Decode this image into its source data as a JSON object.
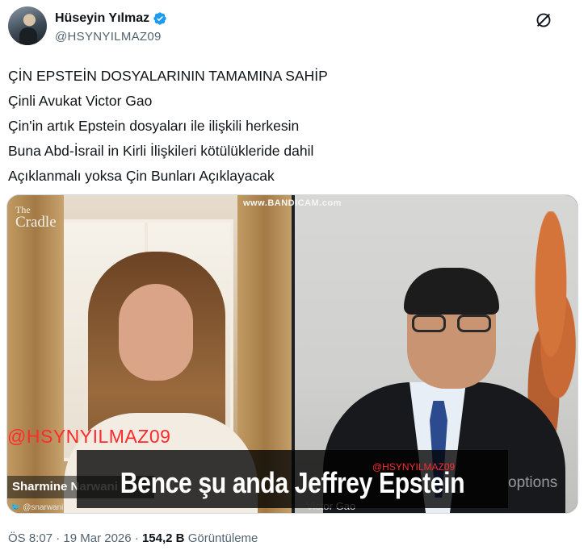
{
  "author": {
    "display_name": "Hüseyin Yılmaz",
    "handle": "@HSYNYILMAZ09",
    "verified_color": "#1d9bf0"
  },
  "tweet": {
    "lines": [
      "ÇİN EPSTEİN DOSYALARININ TAMAMINA SAHİP",
      "Çinli Avukat Victor Gao",
      "Çin'in artık Epstein dosyaları ile ilişkili herkesin",
      "Buna Abd-İsrail in Kirli İlişkileri kötülükleride dahil",
      "Açıklanmalı yoksa Çin Bunları Açıklayacak"
    ]
  },
  "video": {
    "brand_logo": [
      "The",
      "Cradle"
    ],
    "recorder_watermark": "www.BANDICAM.com",
    "watermark_left": "@HSYNYILMAZ09",
    "watermark_center": "@HSYNYILMAZ09",
    "lower_third_left": "Sharmine Narwani",
    "social_left": "🐦 @snarwani",
    "lower_third_right": "Victor Gao",
    "subtitle": "Bence şu anda Jeffrey Epstein",
    "options_text": "options"
  },
  "footer": {
    "time": "ÖS 8:07",
    "sep1": "·",
    "date": "19 Mar 2026",
    "sep2": "·",
    "views_count": "154,2 B",
    "views_label": "Görüntüleme"
  },
  "icons": {
    "grok": "grok-icon",
    "verified": "verified-badge-icon"
  }
}
